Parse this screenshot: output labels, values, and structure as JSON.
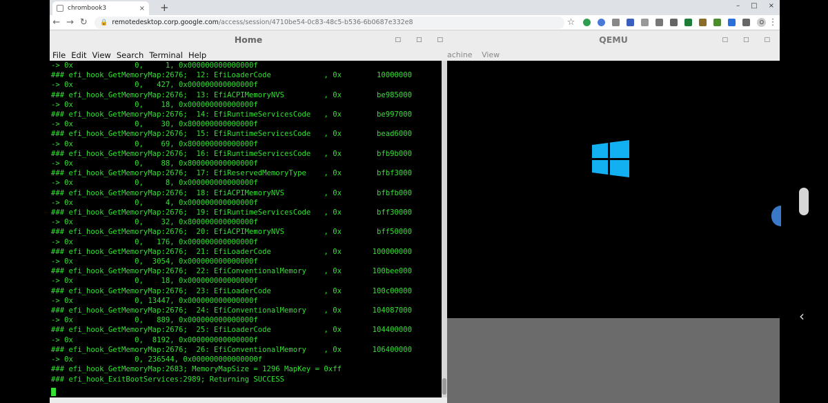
{
  "browser": {
    "tab_title": "chrombook3",
    "tab_close": "×",
    "new_tab": "+",
    "window_buttons": [
      "–",
      "□",
      "×"
    ],
    "url_host": "remotedesktop.corp.google.com",
    "url_path": "/access/session/4710be54-0c83-48c5-b536-6b0687e332e8",
    "profile_initial": "O"
  },
  "terminal": {
    "title": "Home",
    "menu": [
      "File",
      "Edit",
      "View",
      "Search",
      "Terminal",
      "Help"
    ],
    "lines": [
      "-> 0x              0,     1, 0x000000000000000f",
      "### efi_hook_GetMemoryMap:2676;  12: EfiLoaderCode            , 0x        10000000",
      "-> 0x              0,   427, 0x000000000000000f",
      "### efi_hook_GetMemoryMap:2676;  13: EfiACPIMemoryNVS         , 0x        be985000",
      "-> 0x              0,    18, 0x000000000000000f",
      "### efi_hook_GetMemoryMap:2676;  14: EfiRuntimeServicesCode   , 0x        be997000",
      "-> 0x              0,    30, 0x800000000000000f",
      "### efi_hook_GetMemoryMap:2676;  15: EfiRuntimeServicesCode   , 0x        bead6000",
      "-> 0x              0,    69, 0x800000000000000f",
      "### efi_hook_GetMemoryMap:2676;  16: EfiRuntimeServicesCode   , 0x        bfb9b000",
      "-> 0x              0,    88, 0x800000000000000f",
      "### efi_hook_GetMemoryMap:2676;  17: EfiReservedMemoryType    , 0x        bfbf3000",
      "-> 0x              0,     8, 0x000000000000000f",
      "### efi_hook_GetMemoryMap:2676;  18: EfiACPIMemoryNVS         , 0x        bfbfb000",
      "-> 0x              0,     4, 0x000000000000000f",
      "### efi_hook_GetMemoryMap:2676;  19: EfiRuntimeServicesCode   , 0x        bff30000",
      "-> 0x              0,    32, 0x800000000000000f",
      "### efi_hook_GetMemoryMap:2676;  20: EfiACPIMemoryNVS         , 0x        bff50000",
      "-> 0x              0,   176, 0x000000000000000f",
      "### efi_hook_GetMemoryMap:2676;  21: EfiLoaderCode            , 0x       100000000",
      "-> 0x              0,  3054, 0x000000000000000f",
      "### efi_hook_GetMemoryMap:2676;  22: EfiConventionalMemory    , 0x       100bee000",
      "-> 0x              0,    18, 0x000000000000000f",
      "### efi_hook_GetMemoryMap:2676;  23: EfiLoaderCode            , 0x       100c00000",
      "-> 0x              0, 13447, 0x000000000000000f",
      "### efi_hook_GetMemoryMap:2676;  24: EfiConventionalMemory    , 0x       104087000",
      "-> 0x              0,   889, 0x000000000000000f",
      "### efi_hook_GetMemoryMap:2676;  25: EfiLoaderCode            , 0x       104400000",
      "-> 0x              0,  8192, 0x000000000000000f",
      "### efi_hook_GetMemoryMap:2676;  26: EfiConventionalMemory    , 0x       106400000",
      "-> 0x              0, 236544, 0x000000000000000f",
      "### efi_hook_GetMemoryMap:2683; MemoryMapSize = 1296 MapKey = 0xff",
      "### efi_hook_ExitBootServices:2989; Returning SUCCESS"
    ]
  },
  "qemu": {
    "title": "QEMU",
    "menu": [
      "achine",
      "View"
    ]
  },
  "colors": {
    "terminal_text": "#33e033",
    "windows_logo": "#12b0f0"
  }
}
